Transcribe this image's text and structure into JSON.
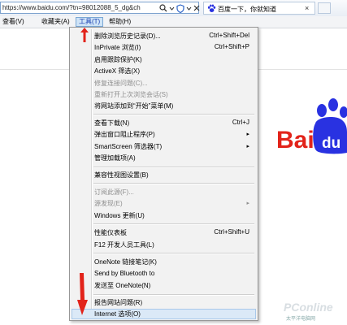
{
  "addressbar": {
    "url": "https://www.baidu.com/?tn=98012088_5_dg&ch",
    "tab_title": "百度一下，你就知道",
    "tab_close": "×"
  },
  "menubar": {
    "items": [
      "查看(V)",
      "收藏夹(A)",
      "工具(T)",
      "帮助(H)"
    ]
  },
  "menu": {
    "items": [
      {
        "label": "删除浏览历史记录(D)...",
        "shortcut": "Ctrl+Shift+Del"
      },
      {
        "label": "InPrivate 浏览(I)",
        "shortcut": "Ctrl+Shift+P"
      },
      {
        "label": "启用跟踪保护(K)",
        "shortcut": ""
      },
      {
        "label": "ActiveX 筛选(X)",
        "shortcut": ""
      },
      {
        "label": "修复连接问题(C)...",
        "shortcut": "",
        "disabled": true
      },
      {
        "label": "重新打开上次浏览会话(S)",
        "shortcut": "",
        "disabled": true
      },
      {
        "label": "将网站添加到“开始”菜单(M)",
        "shortcut": ""
      },
      {
        "label": "查看下载(N)",
        "shortcut": "Ctrl+J"
      },
      {
        "label": "弹出窗口阻止程序(P)",
        "shortcut": "",
        "submenu": true
      },
      {
        "label": "SmartScreen 筛选器(T)",
        "shortcut": "",
        "submenu": true
      },
      {
        "label": "管理加载项(A)",
        "shortcut": ""
      },
      {
        "label": "兼容性视图设置(B)",
        "shortcut": ""
      },
      {
        "label": "订阅此源(F)...",
        "shortcut": "",
        "disabled": true
      },
      {
        "label": "源发现(E)",
        "shortcut": "",
        "disabled": true,
        "submenu": true
      },
      {
        "label": "Windows 更新(U)",
        "shortcut": ""
      },
      {
        "label": "性能仪表板",
        "shortcut": "Ctrl+Shift+U"
      },
      {
        "label": "F12 开发人员工具(L)",
        "shortcut": ""
      },
      {
        "label": "OneNote 链接笔记(K)",
        "shortcut": ""
      },
      {
        "label": "Send by Bluetooth to",
        "shortcut": ""
      },
      {
        "label": "发送至 OneNote(N)",
        "shortcut": ""
      },
      {
        "label": "报告网站问题(R)",
        "shortcut": ""
      },
      {
        "label": "Internet 选项(O)",
        "shortcut": "",
        "highlighted": true
      }
    ],
    "submenu_arrow": "▸"
  },
  "page": {
    "logo_text_1": "Bai",
    "logo_text_2": "du",
    "watermark": "PConline",
    "watermark_sub": "太平洋电脑网"
  },
  "colors": {
    "accent_red": "#e2231a",
    "baidu_blue": "#2932e1",
    "highlight_bg": "#dbe9f7"
  }
}
